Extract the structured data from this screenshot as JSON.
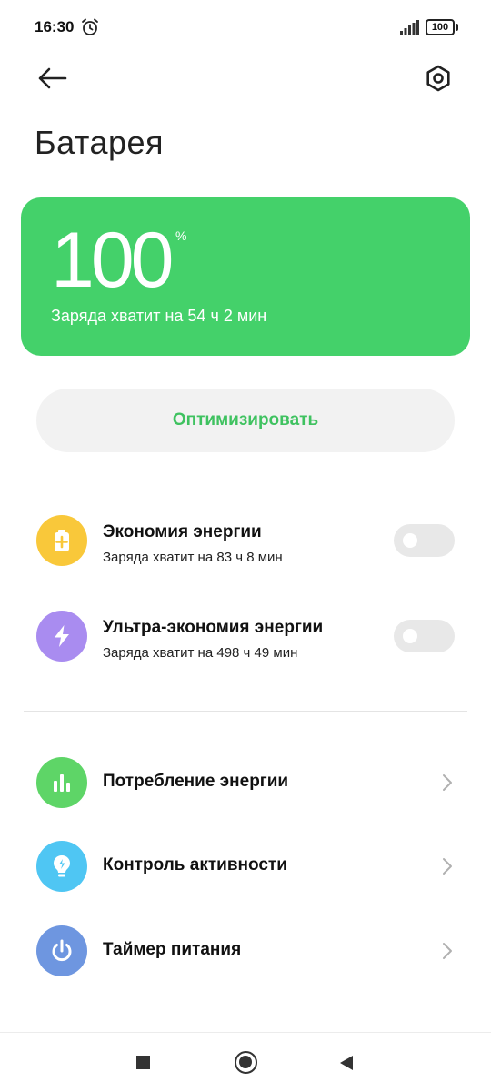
{
  "status_bar": {
    "time": "16:30",
    "battery_level": "100",
    "icons": [
      "alarm-icon",
      "signal-icon",
      "battery-icon"
    ]
  },
  "header": {
    "back_icon": "arrow-left-icon",
    "settings_icon": "hexagon-gear-icon",
    "title": "Батарея"
  },
  "battery_card": {
    "percent": "100",
    "percent_sign": "%",
    "remaining": "Заряда хватит на 54 ч 2 мин",
    "color": "#44d16a"
  },
  "optimize_button": {
    "label": "Оптимизировать",
    "color": "#3fc260"
  },
  "modes": [
    {
      "title": "Экономия энергии",
      "subtitle": "Заряда хватит на 83 ч 8 мин",
      "icon": "battery-plus-icon",
      "icon_color": "#f9c83a",
      "enabled": false
    },
    {
      "title": "Ультра-экономия энергии",
      "subtitle": "Заряда хватит на 498 ч 49 мин",
      "icon": "lightning-icon",
      "icon_color": "#a98cf0",
      "enabled": false
    }
  ],
  "nav_items": [
    {
      "label": "Потребление энергии",
      "icon": "bar-chart-icon",
      "icon_color": "#5ed567"
    },
    {
      "label": "Контроль активности",
      "icon": "lightbulb-icon",
      "icon_color": "#4fc6f3"
    },
    {
      "label": "Таймер питания",
      "icon": "power-icon",
      "icon_color": "#6e96e0"
    }
  ],
  "system_nav": {
    "icons": [
      "recents-square-icon",
      "home-circle-icon",
      "back-triangle-icon"
    ]
  }
}
